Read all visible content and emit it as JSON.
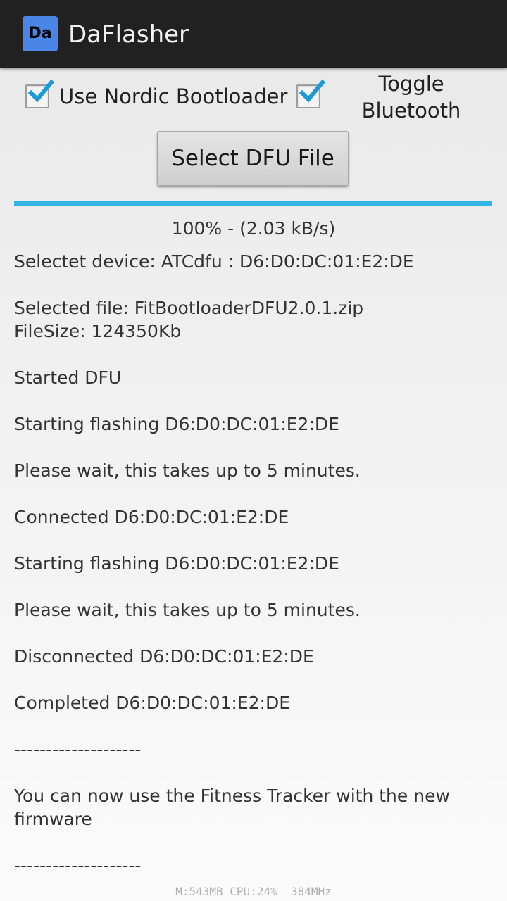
{
  "app_bar": {
    "icon_text": "Da",
    "icon_color": "#4a86e8",
    "title": "DaFlasher"
  },
  "controls": {
    "nordic_checkbox": {
      "label": "Use Nordic Bootloader",
      "checked": true
    },
    "bluetooth_checkbox": {
      "checked": true
    },
    "toggle_label": "Toggle Bluetooth",
    "select_button_label": "Select DFU File"
  },
  "progress": {
    "percent": 100,
    "text": "100% - (2.03 kB/s)",
    "color": "#33b5e5"
  },
  "log": {
    "selected_device": "Selectet device: ATCdfu : D6:D0:DC:01:E2:DE",
    "selected_file": "Selected file: FitBootloaderDFU2.0.1.zip",
    "file_size": "FileSize: 124350Kb",
    "started": "Started DFU",
    "starting_flashing_1": "Starting flashing D6:D0:DC:01:E2:DE",
    "please_wait_1": "Please wait, this takes up to 5 minutes.",
    "connected": "Connected D6:D0:DC:01:E2:DE",
    "starting_flashing_2": "Starting flashing D6:D0:DC:01:E2:DE",
    "please_wait_2": "Please wait, this takes up to 5 minutes.",
    "disconnected": "Disconnected D6:D0:DC:01:E2:DE",
    "completed": "Completed D6:D0:DC:01:E2:DE",
    "separator_1": "--------------------",
    "final_message": "You can now use the Fitness Tracker with the new firmware",
    "separator_2": "--------------------"
  },
  "overlay": {
    "status": "M:543MB CPU:24%  384MHz"
  }
}
